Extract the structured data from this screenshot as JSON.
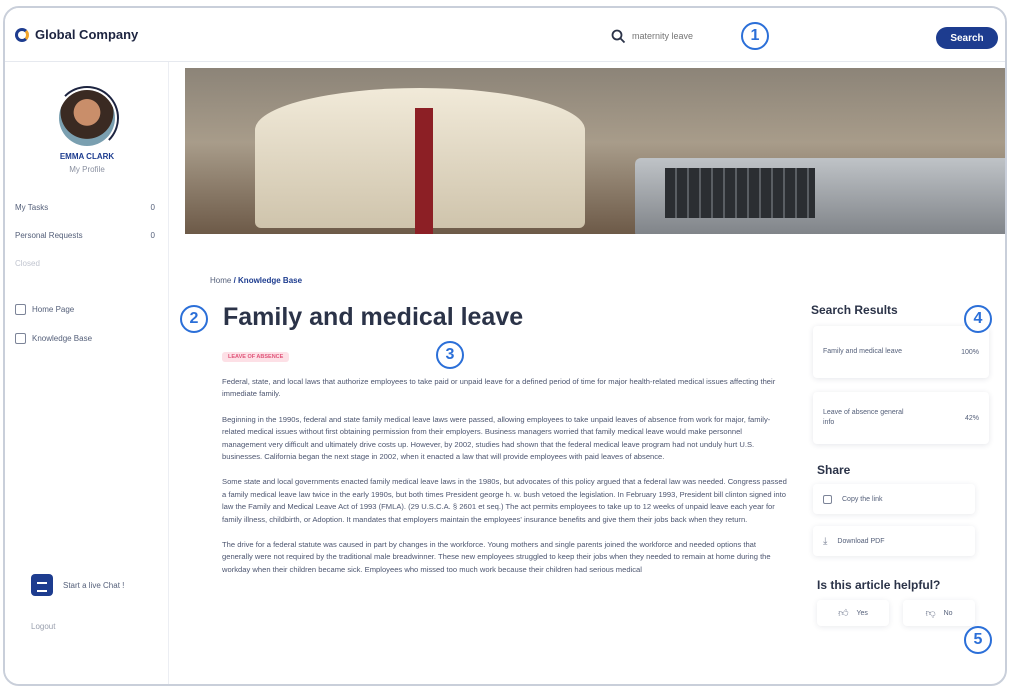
{
  "header": {
    "company_name": "Global Company",
    "search_placeholder": "maternity leave",
    "search_button": "Search"
  },
  "callouts": [
    "1",
    "2",
    "3",
    "4",
    "5"
  ],
  "sidebar": {
    "profile_name": "EMMA CLARK",
    "profile_link": "My Profile",
    "counters": [
      {
        "label": "My Tasks",
        "count": "0"
      },
      {
        "label": "Personal Requests",
        "count": "0"
      },
      {
        "label": "Closed",
        "count": ""
      }
    ],
    "nav": [
      {
        "label": "Home Page",
        "icon": "home-icon"
      },
      {
        "label": "Knowledge Base",
        "icon": "book-icon"
      }
    ],
    "chat_label": "Start a live Chat !",
    "logout": "Logout"
  },
  "breadcrumb": {
    "home": "Home",
    "current": "/ Knowledge Base"
  },
  "article": {
    "title": "Family and medical leave",
    "category_badge": "LEAVE OF ABSENCE",
    "paragraphs": [
      "Federal, state, and local laws that authorize employees to take paid or unpaid leave for a defined period of time for major health-related medical issues affecting their immediate family.",
      "Beginning in the 1990s, federal and state family medical leave laws were passed, allowing employees to take unpaid leaves of absence from work for major, family-related medical issues without first obtaining permission from their employers. Business managers worried that family medical leave would make personnel management very difficult and ultimately drive costs up. However, by 2002, studies had shown that the federal medical leave program had not unduly hurt U.S. businesses. California began the next stage in 2002, when it enacted a law that will provide employees with paid leaves of absence.",
      "Some state and local governments enacted family medical leave laws in the 1980s, but advocates of this policy argued that a federal law was needed. Congress passed a family medical leave law twice in the early 1990s, but both times President george h. w. bush vetoed the legislation. In February 1993, President bill clinton signed into law the Family and Medical Leave Act of 1993 (FMLA). (29 U.S.C.A. § 2601 et seq.) The act permits employees to take up to 12 weeks of unpaid leave each year for family illness, childbirth, or Adoption. It mandates that employers maintain the employees' insurance benefits and give them their jobs back when they return.",
      "The drive for a federal statute was caused in part by changes in the workforce. Young mothers and single parents joined the workforce and needed options that generally were not required by the traditional male breadwinner. These new employees struggled to keep their jobs when they needed to remain at home during the workday when their children became sick. Employees who missed too much work because their children had serious medical"
    ]
  },
  "search_results": {
    "title": "Search Results",
    "items": [
      {
        "label": "Family and medical leave",
        "score": "100%"
      },
      {
        "label": "Leave of absence general info",
        "score": "42%"
      }
    ]
  },
  "share": {
    "title": "Share",
    "copy_link": "Copy the link",
    "download_pdf": "Download PDF"
  },
  "feedback": {
    "title": "Is this article helpful?",
    "yes": "Yes",
    "no": "No"
  }
}
